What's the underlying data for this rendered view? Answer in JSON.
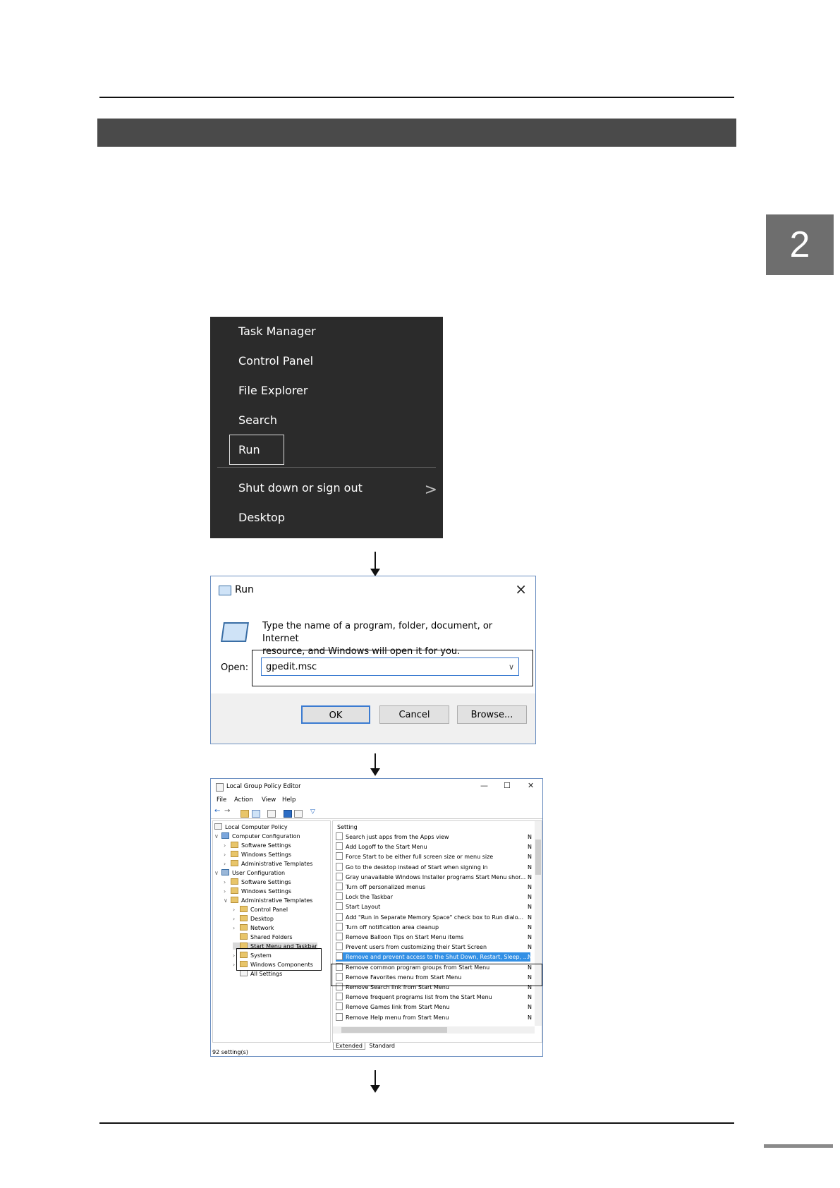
{
  "chapter": {
    "number": "2"
  },
  "winx_menu": {
    "items": [
      "Task Manager",
      "Control Panel",
      "File Explorer",
      "Search",
      "Run"
    ],
    "bottom_items": [
      "Shut down or sign out",
      "Desktop"
    ],
    "chevron": ">"
  },
  "run_dialog": {
    "title": "Run",
    "close": "×",
    "description_line1": "Type the name of a program, folder, document, or Internet",
    "description_line2": "resource, and Windows will open it for you.",
    "open_label": "Open:",
    "open_value": "gpedit.msc",
    "buttons": {
      "ok": "OK",
      "cancel": "Cancel",
      "browse": "Browse..."
    }
  },
  "gpe": {
    "title": "Local Group Policy Editor",
    "window_controls": {
      "minimize": "—",
      "maximize": "☐",
      "close": "✕"
    },
    "menu": [
      "File",
      "Action",
      "View",
      "Help"
    ],
    "tree": [
      "Local Computer Policy",
      "Computer Configuration",
      "Software Settings",
      "Windows Settings",
      "Administrative Templates",
      "User Configuration",
      "Software Settings",
      "Windows Settings",
      "Administrative Templates",
      "Control Panel",
      "Desktop",
      "Network",
      "Shared Folders",
      "Start Menu and Taskbar",
      "System",
      "Windows Components",
      "All Settings"
    ],
    "list_header": "Setting",
    "settings": [
      "Search just apps from the Apps view",
      "Add Logoff to the Start Menu",
      "Force Start to be either full screen size or menu size",
      "Go to the desktop instead of Start when signing in",
      "Gray unavailable Windows Installer programs Start Menu shor...",
      "Turn off personalized menus",
      "Lock the Taskbar",
      "Start Layout",
      "Add \"Run in Separate Memory Space\" check box to Run dialo...",
      "Turn off notification area cleanup",
      "Remove Balloon Tips on Start Menu items",
      "Prevent users from customizing their Start Screen",
      "Remove and prevent access to the Shut Down, Restart, Sleep, ...",
      "Remove common program groups from Start Menu",
      "Remove Favorites menu from Start Menu",
      "Remove Search link from Start Menu",
      "Remove frequent programs list from the Start Menu",
      "Remove Games link from Start Menu",
      "Remove Help menu from Start Menu"
    ],
    "state_abbrev": "N",
    "tabs": {
      "extended": "Extended",
      "standard": "Standard"
    },
    "status": "92 setting(s)"
  }
}
